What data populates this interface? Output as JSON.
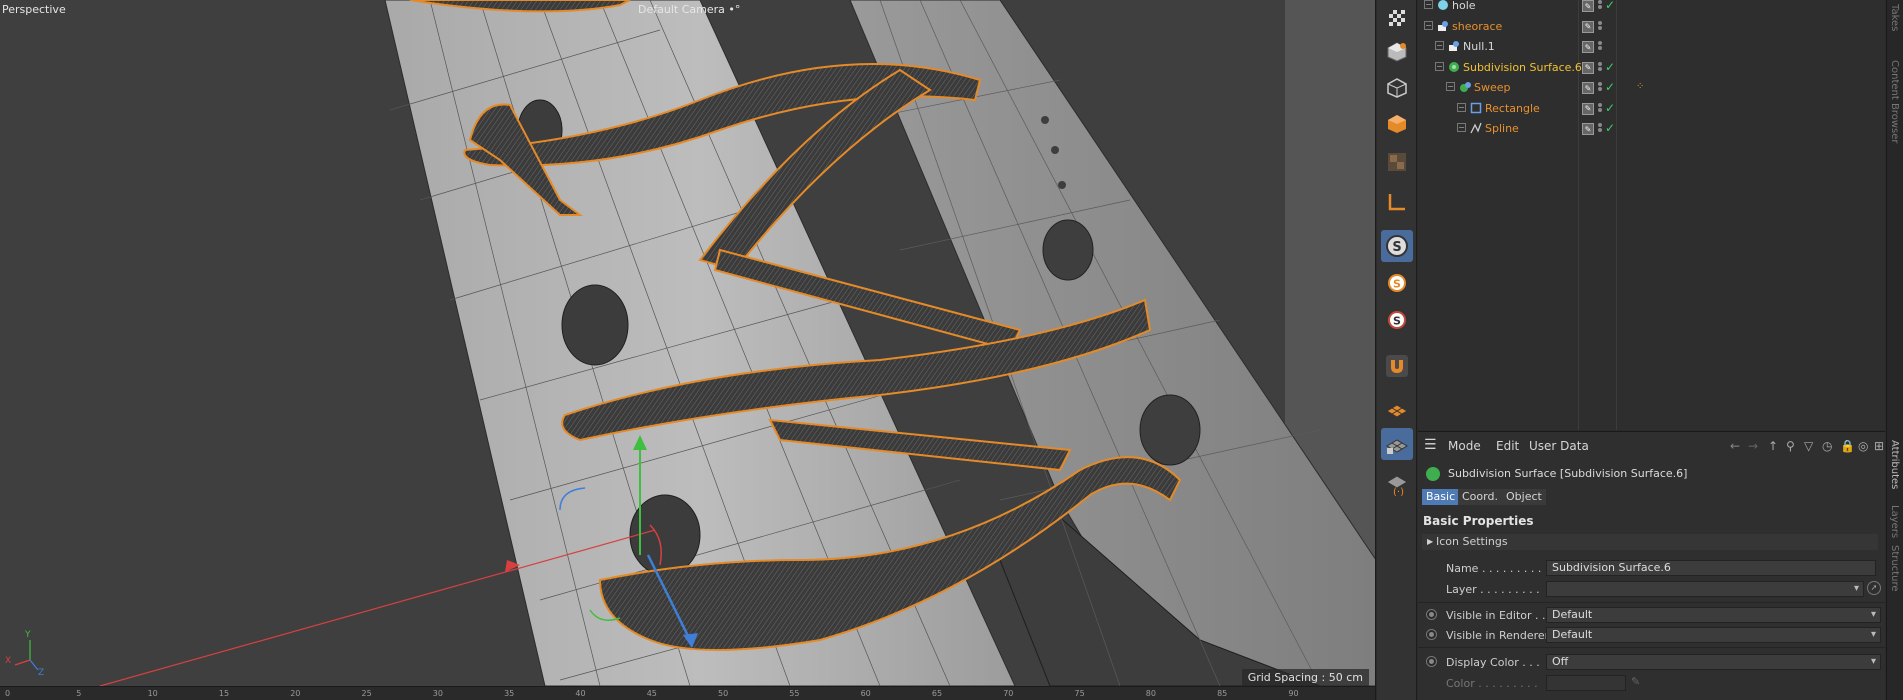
{
  "viewport": {
    "name": "Perspective",
    "camera": "Default Camera",
    "camera_suffix": "•°",
    "grid_spacing": "Grid Spacing : 50 cm",
    "axis_labels": {
      "x": "X",
      "y": "Y",
      "z": "Z"
    }
  },
  "timeline": {
    "ticks": [
      "0",
      "5",
      "10",
      "15",
      "20",
      "25",
      "30",
      "35",
      "40",
      "45",
      "50",
      "55",
      "60",
      "65",
      "70",
      "75",
      "80",
      "85",
      "90"
    ]
  },
  "toolbar": {
    "tools": [
      "checker-icon",
      "cube-icon",
      "cube-outline-icon",
      "cube-solid-icon",
      "texture-icon",
      "axis-icon",
      "snap-s-icon",
      "snap-s-orange-icon",
      "snap-s-red-icon",
      "magnet-icon",
      "grid-plane-icon",
      "grid-lock-icon",
      "grid-refresh-icon"
    ]
  },
  "objects": {
    "rows": [
      {
        "name": "hole",
        "color": "white",
        "indent": 0,
        "icon": "sphere-icon"
      },
      {
        "name": "sheorace",
        "color": "orange",
        "indent": 0,
        "icon": "null-icon"
      },
      {
        "name": "Null.1",
        "color": "white",
        "indent": 1,
        "icon": "null-icon"
      },
      {
        "name": "Subdivision Surface.6",
        "color": "yellow",
        "indent": 1,
        "icon": "subdivision-icon"
      },
      {
        "name": "Sweep",
        "color": "orange",
        "indent": 2,
        "icon": "sweep-icon"
      },
      {
        "name": "Rectangle",
        "color": "orange",
        "indent": 3,
        "icon": "rectangle-icon"
      },
      {
        "name": "Spline",
        "color": "orange",
        "indent": 3,
        "icon": "spline-icon"
      }
    ]
  },
  "attributes": {
    "menu": {
      "mode": "Mode",
      "edit": "Edit",
      "user_data": "User Data"
    },
    "title": "Subdivision Surface [Subdivision Surface.6]",
    "tabs": [
      "Basic",
      "Coord.",
      "Object"
    ],
    "section": "Basic Properties",
    "icon_settings": "Icon Settings",
    "fields": {
      "name_label": "Name . . . . . . . . .",
      "name_value": "Subdivision Surface.6",
      "layer_label": "Layer . . . . . . . . .",
      "editor_label": "Visible in Editor . .",
      "editor_value": "Default",
      "renderer_label": "Visible in Renderer",
      "renderer_value": "Default",
      "display_color_label": "Display Color . . .",
      "display_color_value": "Off",
      "color_label": "Color . . . . . . . . ."
    }
  },
  "side_tabs": [
    "Takes",
    "Content Browser",
    "Attributes",
    "Layers",
    "Structure"
  ]
}
